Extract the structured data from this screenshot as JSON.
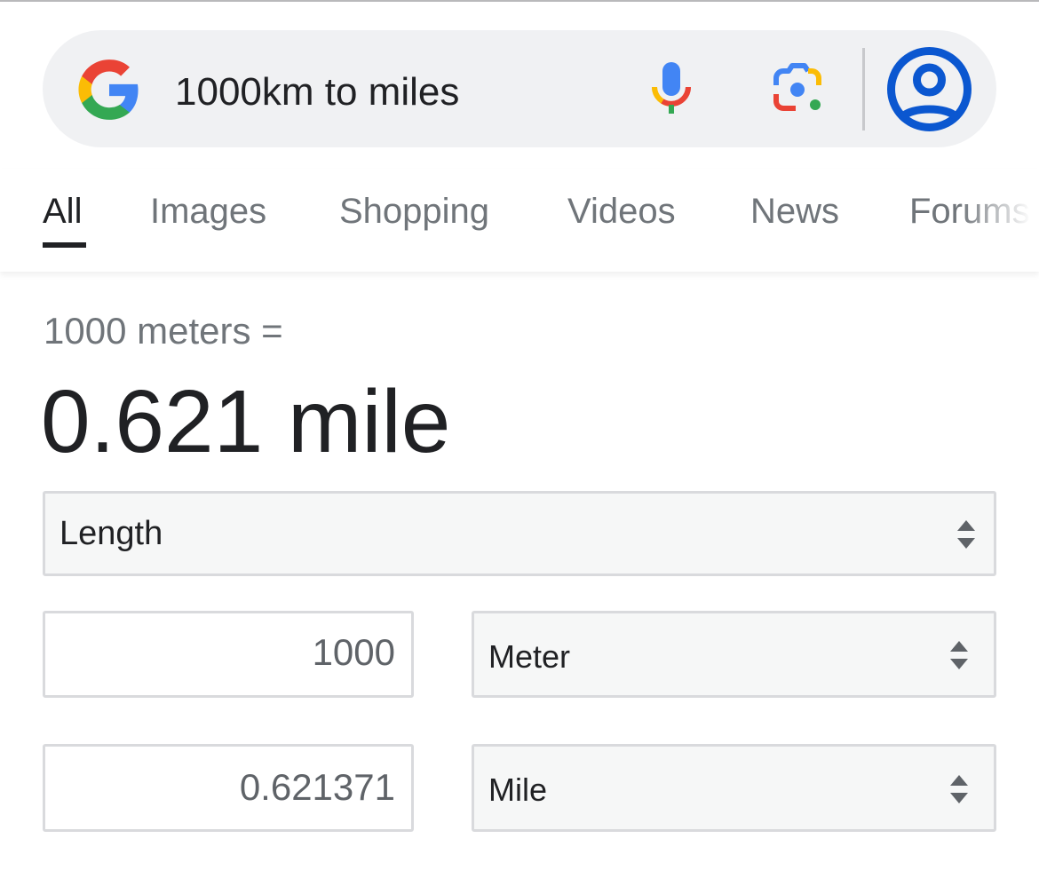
{
  "search": {
    "query": "1000km to miles",
    "icons": {
      "logo": "google-g-logo",
      "voice": "mic-icon",
      "lens": "google-lens-icon",
      "account": "account-circle-icon"
    }
  },
  "tabs": [
    {
      "label": "All",
      "active": true
    },
    {
      "label": "Images",
      "active": false
    },
    {
      "label": "Shopping",
      "active": false
    },
    {
      "label": "Videos",
      "active": false
    },
    {
      "label": "News",
      "active": false
    },
    {
      "label": "Forums",
      "active": false
    }
  ],
  "converter": {
    "from_summary": "1000 meters =",
    "result": "0.621 mile",
    "category": "Length",
    "from_value": "1000",
    "from_unit": "Meter",
    "to_value": "0.621371",
    "to_unit": "Mile"
  },
  "colors": {
    "google_blue": "#4285f4",
    "google_red": "#ea4335",
    "google_yellow": "#fbbc05",
    "google_green": "#34a853",
    "avatar_blue": "#0b57d0"
  }
}
